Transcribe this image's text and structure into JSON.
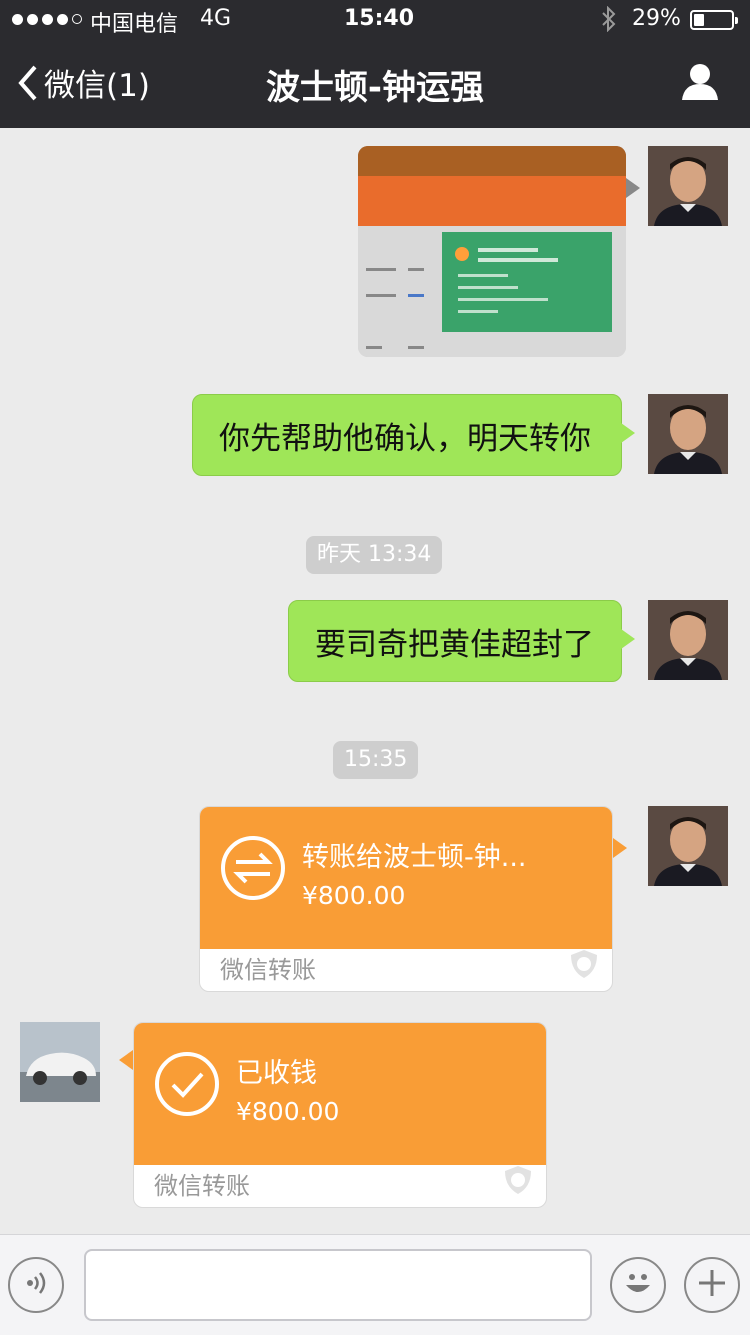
{
  "status_bar": {
    "signal_strength": 4,
    "carrier": "中国电信",
    "network": "4G",
    "time": "15:40",
    "battery": "29%",
    "battery_level": 0.29
  },
  "nav": {
    "back_label": "微信(1)",
    "title": "波士顿-钟运强"
  },
  "messages": [
    {
      "type": "image",
      "side": "right",
      "description_icon": "photo-of-screen"
    },
    {
      "type": "text",
      "side": "right",
      "text": "你先帮助他确认，明天转你"
    },
    {
      "type": "timestamp",
      "text": "昨天 13:34"
    },
    {
      "type": "text",
      "side": "right",
      "text": "要司奇把黄佳超封了"
    },
    {
      "type": "timestamp",
      "text": "15:35"
    },
    {
      "type": "transfer",
      "side": "right",
      "title": "转账给波士顿-钟...",
      "amount": "¥800.00",
      "footer": "微信转账"
    },
    {
      "type": "transfer_received",
      "side": "left",
      "title": "已收钱",
      "amount": "¥800.00",
      "footer": "微信转账"
    }
  ],
  "input_bar": {
    "value": ""
  },
  "colors": {
    "header_bg": "#2b2b2f",
    "chat_bg": "#ebebeb",
    "bubble_green": "#9fe658",
    "transfer_orange": "#f99d36"
  }
}
